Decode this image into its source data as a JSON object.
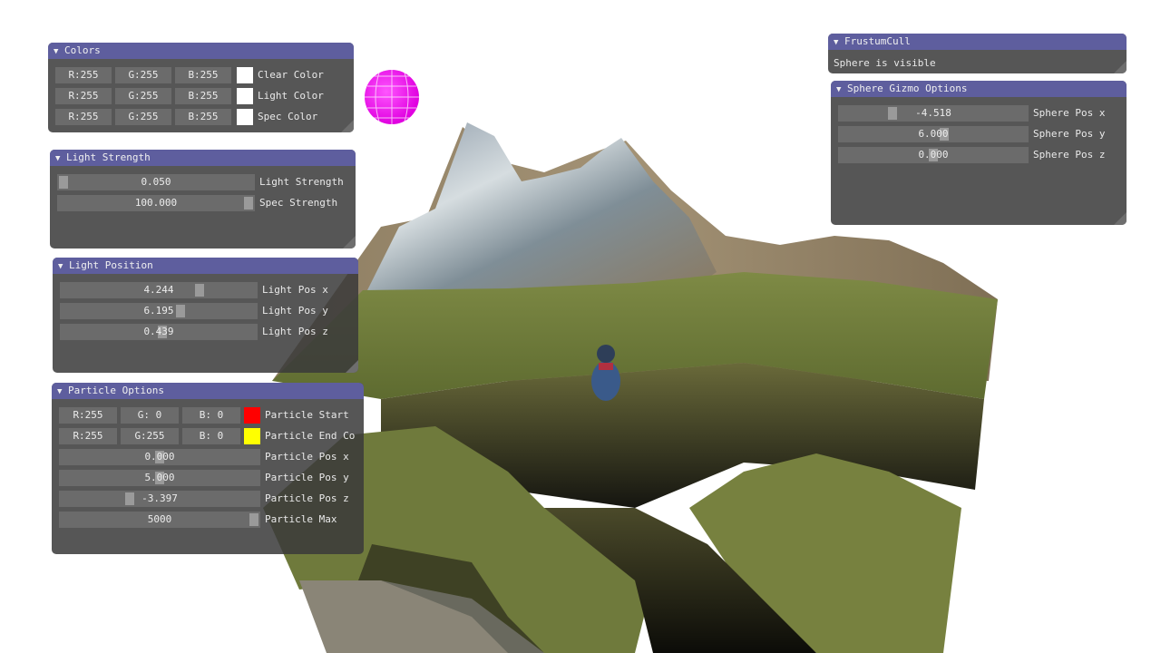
{
  "colors_window": {
    "title": "Colors",
    "rows": [
      {
        "r": "R:255",
        "g": "G:255",
        "b": "B:255",
        "label": "Clear Color",
        "swatch": "#ffffff"
      },
      {
        "r": "R:255",
        "g": "G:255",
        "b": "B:255",
        "label": "Light Color",
        "swatch": "#ffffff"
      },
      {
        "r": "R:255",
        "g": "G:255",
        "b": "B:255",
        "label": "Spec Color",
        "swatch": "#ffffff"
      }
    ]
  },
  "light_strength_window": {
    "title": "Light Strength",
    "sliders": [
      {
        "value": "0.050",
        "label": "Light Strength",
        "fraction": 0.0
      },
      {
        "value": "100.000",
        "label": "Spec Strength",
        "fraction": 1.0
      }
    ]
  },
  "light_position_window": {
    "title": "Light Position",
    "sliders": [
      {
        "value": "4.244",
        "label": "Light Pos x",
        "fraction": 0.72
      },
      {
        "value": "6.195",
        "label": "Light Pos y",
        "fraction": 0.62
      },
      {
        "value": "0.439",
        "label": "Light Pos z",
        "fraction": 0.52
      }
    ]
  },
  "particle_window": {
    "title": "Particle Options",
    "color_rows": [
      {
        "r": "R:255",
        "g": "G:  0",
        "b": "B:  0",
        "label": "Particle Start",
        "swatch": "#ff0000"
      },
      {
        "r": "R:255",
        "g": "G:255",
        "b": "B:  0",
        "label": "Particle End Co",
        "swatch": "#ffff00"
      }
    ],
    "sliders": [
      {
        "value": "0.000",
        "label": "Particle Pos x",
        "fraction": 0.5
      },
      {
        "value": "5.000",
        "label": "Particle Pos y",
        "fraction": 0.5
      },
      {
        "value": "-3.397",
        "label": "Particle Pos z",
        "fraction": 0.34
      },
      {
        "value": "5000",
        "label": "Particle Max",
        "fraction": 1.0
      }
    ]
  },
  "frustum_window": {
    "title": "FrustumCull",
    "status": "Sphere is visible"
  },
  "sphere_window": {
    "title": "Sphere Gizmo Options",
    "sliders": [
      {
        "value": "-4.518",
        "label": "Sphere Pos x",
        "fraction": 0.27
      },
      {
        "value": "6.000",
        "label": "Sphere Pos y",
        "fraction": 0.56
      },
      {
        "value": "0.000",
        "label": "Sphere Pos z",
        "fraction": 0.5
      }
    ]
  },
  "theme": {
    "title_bar": "#5e5e9e",
    "window_bg": "#3a3a3a",
    "field_bg": "#6b6b6b",
    "gizmo_sphere": "#ff22ff"
  }
}
